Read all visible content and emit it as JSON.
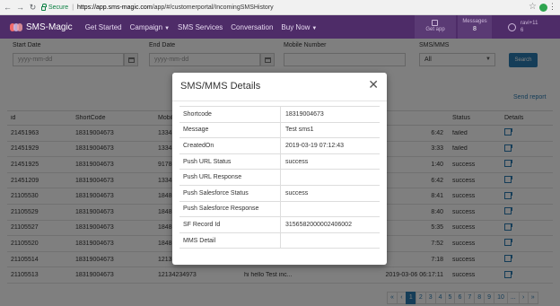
{
  "browser": {
    "secure_label": "Secure",
    "url_host": "https://app.sms-magic.com",
    "url_path": "/app/#/customerportal/IncomingSMSHistory"
  },
  "header": {
    "logo_text": "SMS-Magic",
    "nav": [
      "Get Started",
      "Campaign",
      "SMS Services",
      "Conversation",
      "Buy Now"
    ],
    "get_app": "Get app",
    "messages_label": "Messages",
    "messages_count": "8",
    "user_line1": "ravi+11",
    "user_line2": "6",
    "brand_color": "#4e2c68"
  },
  "filters": {
    "start_label": "Start Date",
    "start_placeholder": "yyyy-mm-dd",
    "end_label": "End Date",
    "end_placeholder": "yyyy-mm-dd",
    "mobile_label": "Mobile Number",
    "type_label": "SMS/MMS",
    "type_value": "All",
    "search_label": "Search"
  },
  "send_report": "Send report",
  "table": {
    "headers": [
      "id",
      "ShortCode",
      "Mobile",
      "",
      "",
      "Status",
      "Details"
    ],
    "rows": [
      {
        "id": "21451963",
        "sc": "18319004673",
        "mob": "1334",
        "msg": "",
        "date": "6:42",
        "status": "failed"
      },
      {
        "id": "21451929",
        "sc": "18319004673",
        "mob": "1334",
        "msg": "",
        "date": "3:33",
        "status": "failed"
      },
      {
        "id": "21451925",
        "sc": "18319004673",
        "mob": "9178",
        "msg": "",
        "date": "1:40",
        "status": "success"
      },
      {
        "id": "21451209",
        "sc": "18319004673",
        "mob": "1334",
        "msg": "",
        "date": "6:42",
        "status": "success"
      },
      {
        "id": "21105530",
        "sc": "18319004673",
        "mob": "1848",
        "msg": "",
        "date": "8:41",
        "status": "success"
      },
      {
        "id": "21105529",
        "sc": "18319004673",
        "mob": "1848",
        "msg": "",
        "date": "8:40",
        "status": "success"
      },
      {
        "id": "21105527",
        "sc": "18319004673",
        "mob": "1848",
        "msg": "",
        "date": "5:35",
        "status": "success"
      },
      {
        "id": "21105520",
        "sc": "18319004673",
        "mob": "1848",
        "msg": "",
        "date": "7:52",
        "status": "success"
      },
      {
        "id": "21105514",
        "sc": "18319004673",
        "mob": "1213",
        "msg": "",
        "date": "7:18",
        "status": "success"
      },
      {
        "id": "21105513",
        "sc": "18319004673",
        "mob": "12134234973",
        "msg": "hi hello Test inc...",
        "date": "2019-03-06 06:17:11",
        "status": "success"
      }
    ]
  },
  "pagination": [
    "«",
    "‹",
    "1",
    "2",
    "3",
    "4",
    "5",
    "6",
    "7",
    "8",
    "9",
    "10",
    "...",
    "›",
    "»"
  ],
  "modal": {
    "title": "SMS/MMS Details",
    "rows": [
      {
        "k": "Shortcode",
        "v": "18319004673"
      },
      {
        "k": "Message",
        "v": "Test sms1"
      },
      {
        "k": "CreatedOn",
        "v": "2019-03-19 07:12:43"
      },
      {
        "k": "Push URL Status",
        "v": "success"
      },
      {
        "k": "Push URL Response",
        "v": ""
      },
      {
        "k": "Push Salesforce Status",
        "v": "success"
      },
      {
        "k": "Push Salesforce Response",
        "v": ""
      },
      {
        "k": "SF Record Id",
        "v": "3156582000002406002"
      },
      {
        "k": "MMS Detail",
        "v": ""
      }
    ]
  }
}
